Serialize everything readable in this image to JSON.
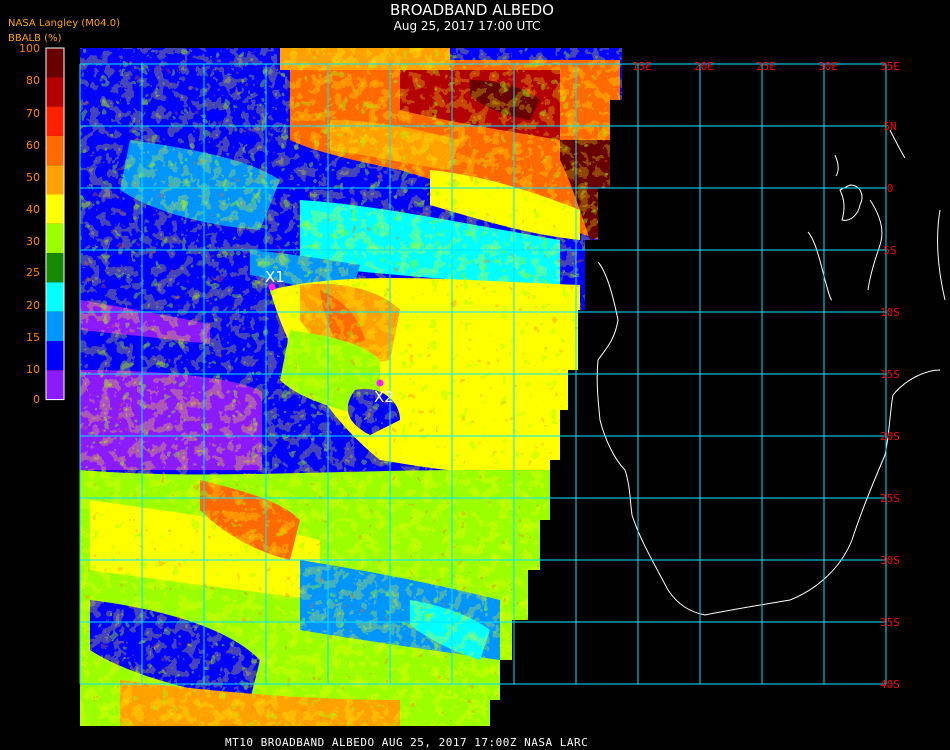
{
  "header": {
    "source": "NASA Langley (M04.0)",
    "title": "BROADBAND ALBEDO",
    "datetime": "Aug 25, 2017 17:00 UTC"
  },
  "colorbar": {
    "label": "BBALB (%)",
    "ticks": [
      "100",
      "80",
      "70",
      "60",
      "50",
      "40",
      "30",
      "25",
      "20",
      "15",
      "10",
      "0"
    ],
    "colors": [
      "#690000",
      "#b30000",
      "#ff2000",
      "#ff6a00",
      "#ffa200",
      "#ffff00",
      "#9cff00",
      "#158a00",
      "#00ffff",
      "#0095ff",
      "#0000ff",
      "#8c1aff"
    ]
  },
  "grid": {
    "longitudes": [
      "15E",
      "20E",
      "25E",
      "30E",
      "35E"
    ],
    "latitudes": [
      "5N",
      "0",
      "5S",
      "10S",
      "15S",
      "20S",
      "25S",
      "30S",
      "35S",
      "40S"
    ],
    "color": "#00e5ff"
  },
  "markers": [
    {
      "label": "X1",
      "color": "#ff1aff"
    },
    {
      "label": "X2",
      "color": "#ff1aff"
    }
  ],
  "footer": "MT10  BROADBAND ALBEDO   AUG 25, 2017 17:00Z   NASA LARC"
}
